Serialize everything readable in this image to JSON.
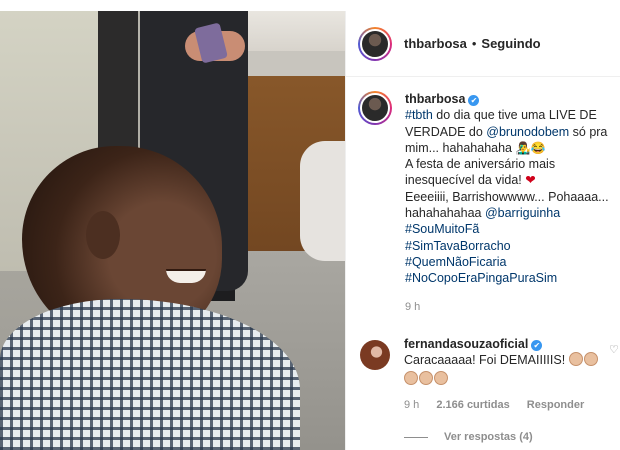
{
  "post": {
    "author": "thbarbosa",
    "follow_status": "Seguindo",
    "separator": "•"
  },
  "caption": {
    "username": "thbarbosa",
    "verified_mark": "✔",
    "lines": {
      "hashtag_tbth": "#tbth",
      "text1": " do dia que tive uma LIVE DE VERDADE do ",
      "mention1": "@brunodobem",
      "text2": " só pra mim... hahahahaha ",
      "emoji1": "👨‍🎤😂",
      "text3": "A festa de aniversário mais inesquecível da vida! ",
      "heart": "❤",
      "text4": "Eeeeiiii, Barrishowwww... Pohaaaa... hahahahahaa ",
      "mention2": "@barriguinha"
    },
    "hashtags": [
      "#SouMuitoFã",
      "#SimTavaBorracho",
      "#QuemNãoFicaria",
      "#NoCopoEraPingaPuraSim"
    ],
    "time": "9 h"
  },
  "comment": {
    "username": "fernandasouzaoficial",
    "verified_mark": "✔",
    "text": "Caracaaaaa! Foi DEMAIIIIIS! ",
    "time": "9 h",
    "likes": "2.166 curtidas",
    "reply": "Responder",
    "view_replies": "Ver respostas (4)"
  },
  "colors": {
    "link": "#00376b",
    "verified": "#3897f0",
    "muted": "#8e8e8e"
  },
  "icons": {
    "like": "heart-outline-icon",
    "verified": "verified-badge-icon"
  }
}
